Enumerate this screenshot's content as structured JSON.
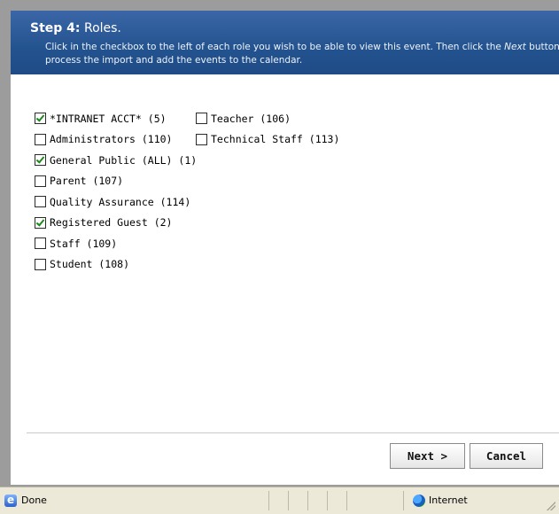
{
  "header": {
    "step_label": "Step 4:",
    "step_name": "Roles.",
    "desc_part1": "Click in the checkbox to the left of each role you wish to be able to view this event. Then click the ",
    "desc_next": "Next",
    "desc_part2": " button to process the import and add the events to the calendar."
  },
  "roles_col1": [
    {
      "label": "*INTRANET ACCT* (5)",
      "checked": true
    },
    {
      "label": "Administrators (110)",
      "checked": false
    },
    {
      "label": "General Public (ALL) (1)",
      "checked": true
    },
    {
      "label": "Parent (107)",
      "checked": false
    },
    {
      "label": "Quality Assurance (114)",
      "checked": false
    },
    {
      "label": "Registered Guest (2)",
      "checked": true
    },
    {
      "label": "Staff (109)",
      "checked": false
    },
    {
      "label": "Student (108)",
      "checked": false
    }
  ],
  "roles_col2": [
    {
      "label": "Teacher (106)",
      "checked": false
    },
    {
      "label": "Technical Staff (113)",
      "checked": false
    }
  ],
  "buttons": {
    "next": "Next >",
    "cancel": "Cancel"
  },
  "statusbar": {
    "status": "Done",
    "zone": "Internet"
  }
}
